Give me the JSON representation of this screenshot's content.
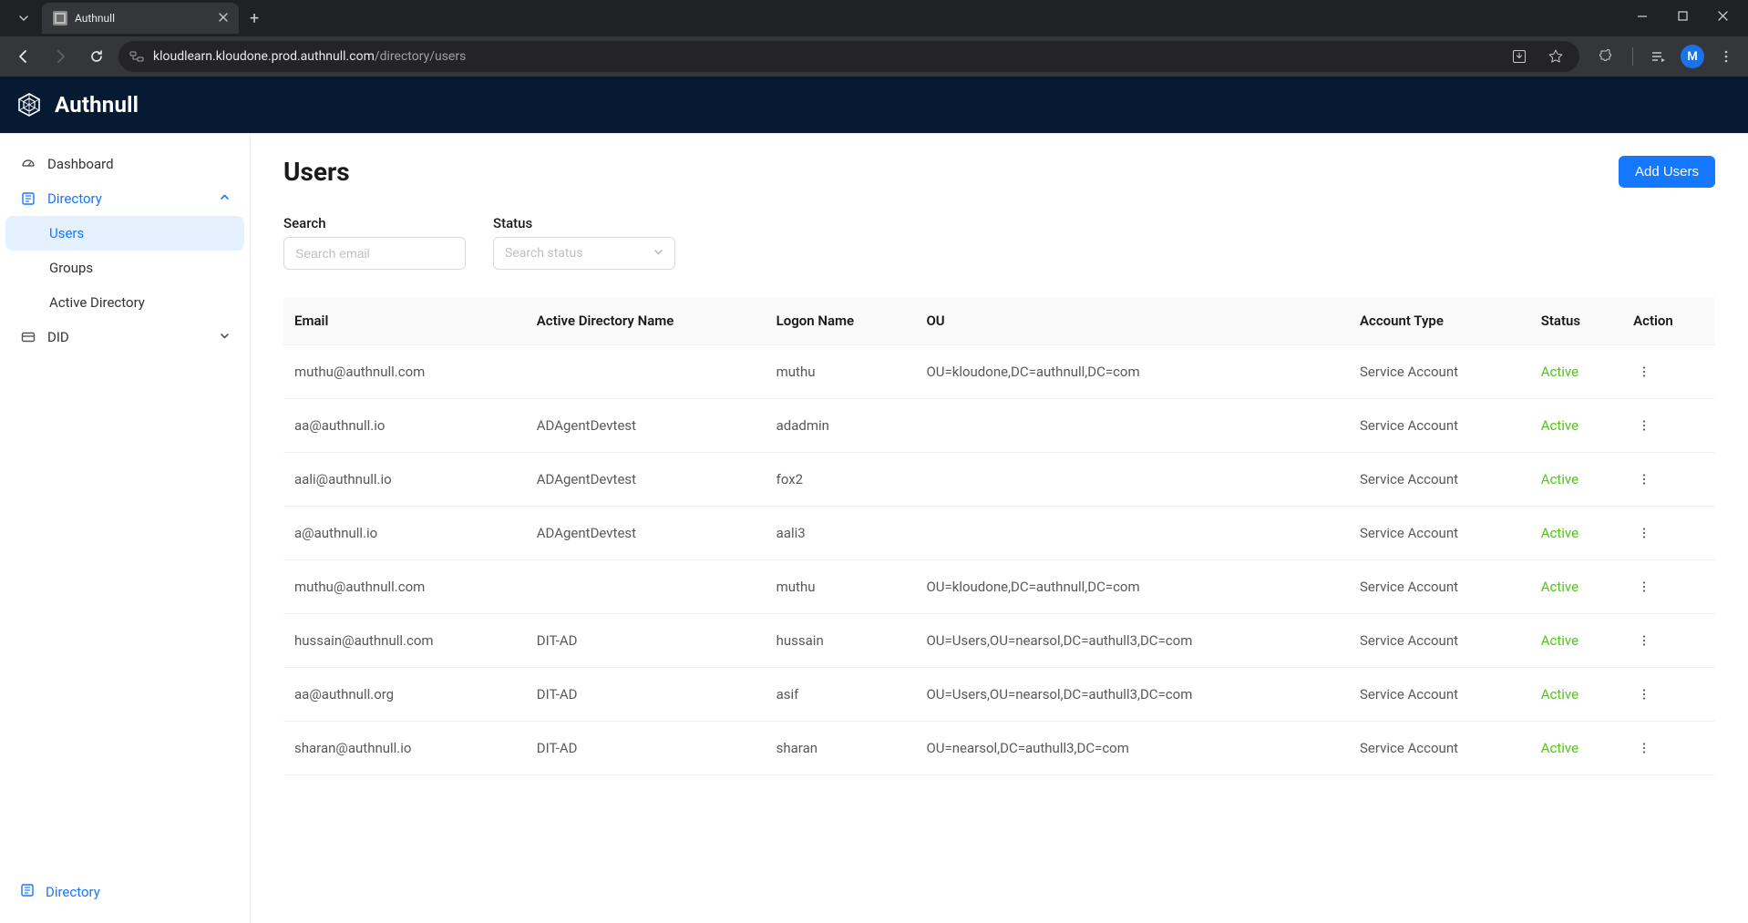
{
  "browser": {
    "tab_title": "Authnull",
    "url_host": "kloudlearn.kloudone.prod.authnull.com",
    "url_path": "/directory/users",
    "profile_initial": "M"
  },
  "app": {
    "brand": "Authnull"
  },
  "sidebar": {
    "items": [
      {
        "label": "Dashboard"
      },
      {
        "label": "Directory"
      },
      {
        "label": "DID"
      }
    ],
    "directory_children": [
      {
        "label": "Users"
      },
      {
        "label": "Groups"
      },
      {
        "label": "Active Directory"
      }
    ],
    "bottom_label": "Directory"
  },
  "page": {
    "title": "Users",
    "add_button": "Add Users",
    "search_label": "Search",
    "search_placeholder": "Search email",
    "status_label": "Status",
    "status_placeholder": "Search status"
  },
  "table": {
    "columns": [
      "Email",
      "Active Directory Name",
      "Logon Name",
      "OU",
      "Account Type",
      "Status",
      "Action"
    ],
    "rows": [
      {
        "email": "muthu@authnull.com",
        "ad": "",
        "logon": "muthu",
        "ou": "OU=kloudone,DC=authnull,DC=com",
        "account": "Service Account",
        "status": "Active"
      },
      {
        "email": "aa@authnull.io",
        "ad": "ADAgentDevtest",
        "logon": "adadmin",
        "ou": "",
        "account": "Service Account",
        "status": "Active"
      },
      {
        "email": "aali@authnull.io",
        "ad": "ADAgentDevtest",
        "logon": "fox2",
        "ou": "",
        "account": "Service Account",
        "status": "Active"
      },
      {
        "email": "a@authnull.io",
        "ad": "ADAgentDevtest",
        "logon": "aali3",
        "ou": "",
        "account": "Service Account",
        "status": "Active"
      },
      {
        "email": "muthu@authnull.com",
        "ad": "",
        "logon": "muthu",
        "ou": "OU=kloudone,DC=authnull,DC=com",
        "account": "Service Account",
        "status": "Active"
      },
      {
        "email": "hussain@authnull.com",
        "ad": "DIT-AD",
        "logon": "hussain",
        "ou": "OU=Users,OU=nearsol,DC=authull3,DC=com",
        "account": "Service Account",
        "status": "Active"
      },
      {
        "email": "aa@authnull.org",
        "ad": "DIT-AD",
        "logon": "asif",
        "ou": "OU=Users,OU=nearsol,DC=authull3,DC=com",
        "account": "Service Account",
        "status": "Active"
      },
      {
        "email": "sharan@authnull.io",
        "ad": "DIT-AD",
        "logon": "sharan",
        "ou": "OU=nearsol,DC=authull3,DC=com",
        "account": "Service Account",
        "status": "Active"
      }
    ]
  }
}
